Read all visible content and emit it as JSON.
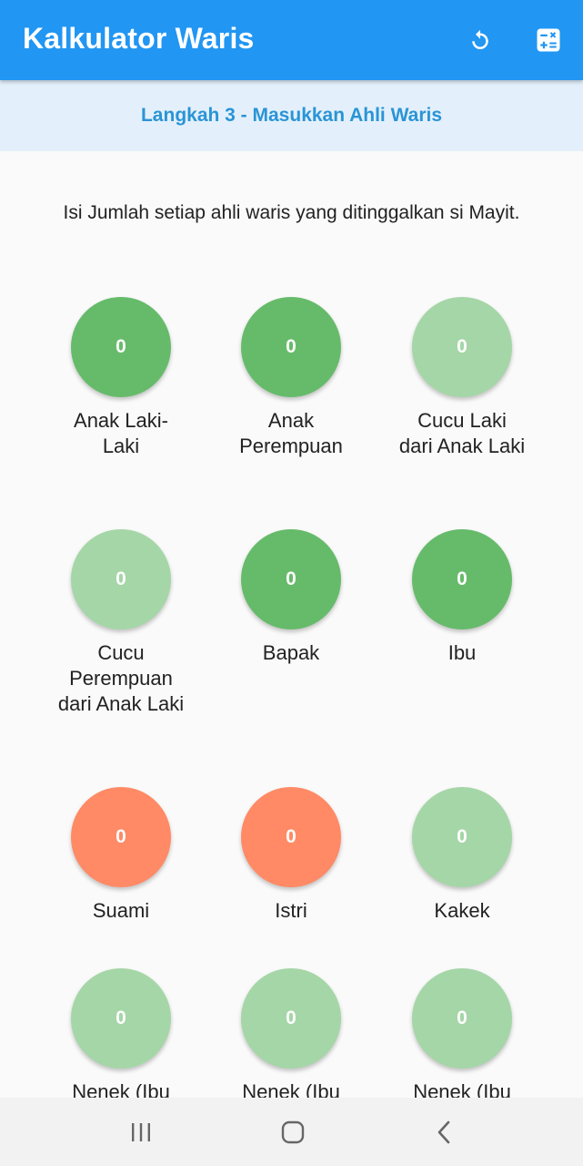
{
  "app_bar": {
    "title": "Kalkulator Waris",
    "reset_icon": "refresh-icon",
    "calculator_icon": "calculator-icon"
  },
  "step": {
    "label": "Langkah 3 - Masukkan Ahli Waris"
  },
  "instruction": "Isi Jumlah setiap ahli waris yang ditinggalkan si Mayit.",
  "heirs": [
    {
      "label": "Anak Laki-Laki",
      "count": "0",
      "color": "#66bb6a"
    },
    {
      "label": "Anak Perempuan",
      "count": "0",
      "color": "#66bb6a"
    },
    {
      "label": "Cucu Laki dari Anak Laki",
      "count": "0",
      "color": "#a5d6a7"
    },
    {
      "label": "Cucu Perempuan dari Anak Laki",
      "count": "0",
      "color": "#a5d6a7"
    },
    {
      "label": "Bapak",
      "count": "0",
      "color": "#66bb6a"
    },
    {
      "label": "Ibu",
      "count": "0",
      "color": "#66bb6a"
    },
    {
      "label": "Suami",
      "count": "0",
      "color": "#ff8a65"
    },
    {
      "label": "Istri",
      "count": "0",
      "color": "#ff8a65"
    },
    {
      "label": "Kakek",
      "count": "0",
      "color": "#a5d6a7"
    },
    {
      "label": "Nenek (Ibu",
      "count": "0",
      "color": "#a5d6a7"
    },
    {
      "label": "Nenek (Ibu",
      "count": "0",
      "color": "#a5d6a7"
    },
    {
      "label": "Nenek (Ibu",
      "count": "0",
      "color": "#a5d6a7"
    }
  ],
  "nav_bar": {
    "recents_icon": "recent-apps-icon",
    "home_icon": "home-icon",
    "back_icon": "back-icon"
  }
}
